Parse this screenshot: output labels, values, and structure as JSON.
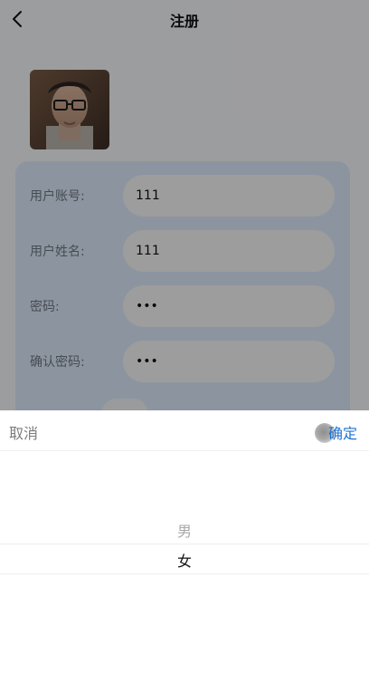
{
  "nav": {
    "title": "注册"
  },
  "form": {
    "rows": [
      {
        "label": "用户账号:",
        "value": "111"
      },
      {
        "label": "用户姓名:",
        "value": "111"
      },
      {
        "label": "密码:",
        "value": "•••"
      },
      {
        "label": "确认密码:",
        "value": "•••"
      }
    ]
  },
  "picker": {
    "cancel_label": "取消",
    "confirm_label": "确定",
    "options": [
      "男",
      "女"
    ],
    "selected": "女"
  },
  "colors": {
    "accent": "#1e73d1",
    "card_bg": "#dbeaf9",
    "overlay": "rgba(0,0,0,0.36)"
  },
  "icons": {
    "back": "chevron-left-icon"
  }
}
